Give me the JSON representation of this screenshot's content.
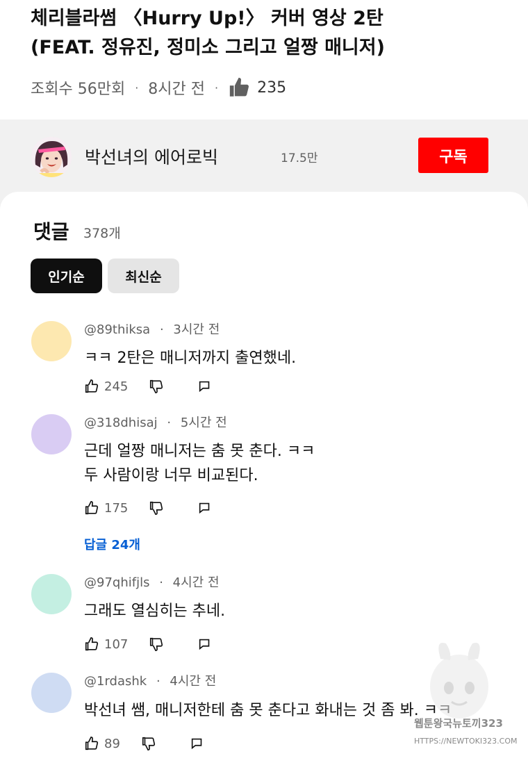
{
  "video": {
    "title_line1": "체리블라썸 〈Hurry Up!〉 커버 영상 2탄",
    "title_line2": "(FEAT. 정유진, 정미소 그리고 얼짱 매니저)",
    "views": "조회수 56만회",
    "time": "8시간 전",
    "likes": "235",
    "separator": "·"
  },
  "channel": {
    "name": "박선녀의 에어로빅",
    "subscribers": "17.5만",
    "subscribe_label": "구독"
  },
  "comments_section": {
    "title": "댓글",
    "count": "378개",
    "sort_popular": "인기순",
    "sort_newest": "최신순",
    "replies_link": "답글 24개"
  },
  "comments": [
    {
      "user": "@89thiksa",
      "time": "3시간 전",
      "text_line1": "ㅋㅋ 2탄은 매니저까지 출연했네.",
      "text_line2": "",
      "likes": "245",
      "avatar_color": "#fde8b0"
    },
    {
      "user": "@318dhisaj",
      "time": "5시간 전",
      "text_line1": "근데 얼짱 매니저는 춤 못 춘다. ㅋㅋ",
      "text_line2": "두 사람이랑 너무 비교된다.",
      "likes": "175",
      "avatar_color": "#d9ccf3"
    },
    {
      "user": "@97qhifjls",
      "time": "4시간 전",
      "text_line1": "그래도 열심히는 추네.",
      "text_line2": "",
      "likes": "107",
      "avatar_color": "#c4efe2"
    },
    {
      "user": "@1rdashk",
      "time": "4시간 전",
      "text_line1": "박선녀 쌤, 매니저한테 춤 못 춘다고 화내는 것 좀 봐. ㅋㅋ",
      "text_line2": "",
      "likes": "89",
      "avatar_color": "#cfdcf3"
    }
  ],
  "watermark": {
    "line1": "웹툰왕국뉴토끼323",
    "line2": "HTTPS://NEWTOKI323.COM"
  },
  "colors": {
    "subscribe_red": "#ff0000",
    "link_blue": "#065fd4",
    "sort_active_bg": "#0f0f0f",
    "sort_inactive_bg": "#e5e5e5",
    "secondary_text": "#606060"
  },
  "icons": {
    "like": "thumbs-up-icon",
    "dislike": "thumbs-down-icon",
    "reply": "reply-icon"
  }
}
